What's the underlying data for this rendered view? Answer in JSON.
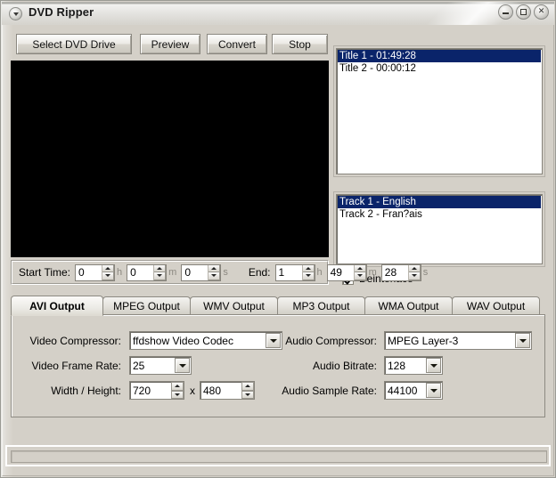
{
  "window": {
    "title": "DVD Ripper",
    "sys_icon": "dropdown-circle-icon",
    "controls": [
      {
        "name": "minimize",
        "glyph": "minimize-icon",
        "label": "_"
      },
      {
        "name": "maximize",
        "glyph": "maximize-icon",
        "label": "□"
      },
      {
        "name": "close",
        "glyph": "close-icon",
        "label": "✕"
      }
    ]
  },
  "toolbar": {
    "select_dvd_drive": "Select DVD Drive",
    "preview": "Preview",
    "convert": "Convert",
    "stop": "Stop"
  },
  "preview": {
    "background_color": "#000000"
  },
  "titles_list": {
    "items": [
      {
        "label": "Title 1 - 01:49:28",
        "selected": true
      },
      {
        "label": "Title 2 - 00:00:12",
        "selected": false
      }
    ]
  },
  "tracks_list": {
    "items": [
      {
        "label": "Track 1 - English",
        "selected": true
      },
      {
        "label": "Track 2 - Fran?ais",
        "selected": false
      }
    ]
  },
  "deinterlace": {
    "label": "Deinterlace",
    "checked": true
  },
  "time_range": {
    "start_label": "Start Time:",
    "start_hours": "0",
    "start_minutes": "0",
    "start_seconds": "0",
    "end_label": "End:",
    "end_hours": "1",
    "end_minutes": "49",
    "end_seconds": "28",
    "unit_hours": "h",
    "unit_minutes": "m",
    "unit_seconds": "s"
  },
  "tabs": [
    {
      "label": "AVI Output",
      "active": true
    },
    {
      "label": "MPEG Output",
      "active": false
    },
    {
      "label": "WMV Output",
      "active": false
    },
    {
      "label": "MP3 Output",
      "active": false
    },
    {
      "label": "WMA Output",
      "active": false
    },
    {
      "label": "WAV Output",
      "active": false
    }
  ],
  "avi_output": {
    "video_compressor_label": "Video Compressor:",
    "video_compressor_value": "ffdshow Video Codec",
    "video_frame_rate_label": "Video Frame Rate:",
    "video_frame_rate_value": "25",
    "width_height_label": "Width / Height:",
    "width_value": "720",
    "height_value": "480",
    "dimension_separator": "x",
    "audio_compressor_label": "Audio Compressor:",
    "audio_compressor_value": "MPEG Layer-3",
    "audio_bitrate_label": "Audio Bitrate:",
    "audio_bitrate_value": "128",
    "audio_sample_rate_label": "Audio Sample Rate:",
    "audio_sample_rate_value": "44100"
  },
  "statusbar": {
    "text": "",
    "progress_percent": 0
  },
  "colors": {
    "window_face": "#d4d0c8",
    "selection_blue": "#0a246a",
    "selection_text": "#ffffff",
    "preview_black": "#000000"
  }
}
